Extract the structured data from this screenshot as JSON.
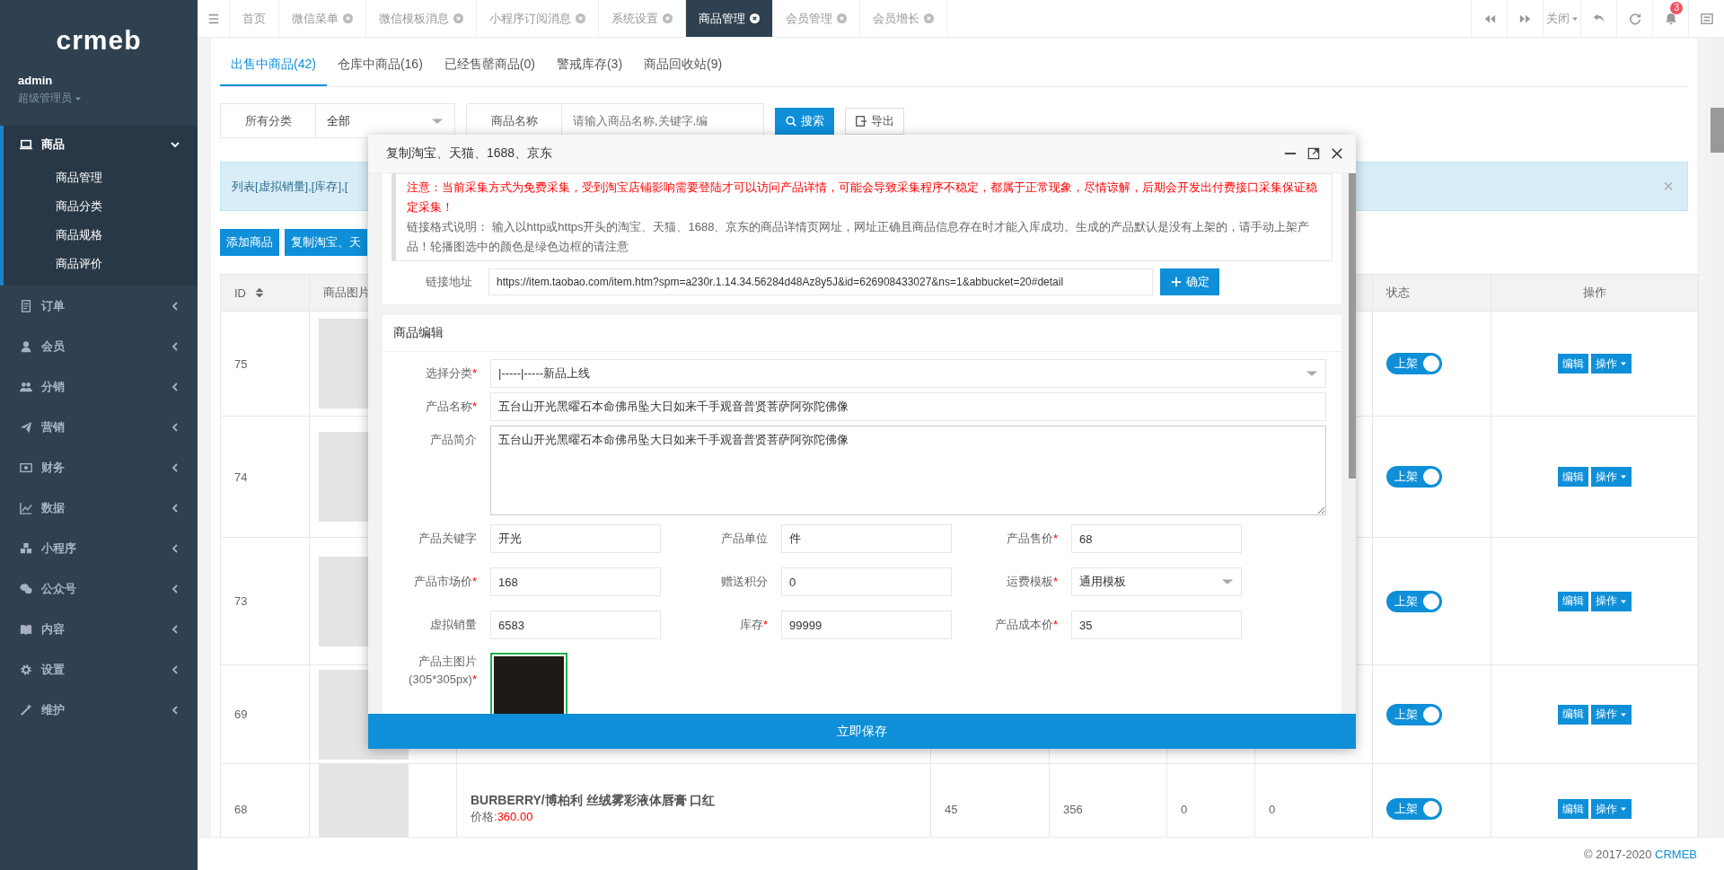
{
  "sidebar": {
    "logo": "crmeb",
    "user": {
      "name": "admin",
      "role": "超级管理员"
    },
    "menu": [
      {
        "label": "商品",
        "selected": true,
        "expanded": true,
        "children": [
          {
            "label": "商品管理"
          },
          {
            "label": "商品分类"
          },
          {
            "label": "商品规格"
          },
          {
            "label": "商品评价"
          }
        ]
      },
      {
        "label": "订单",
        "selected": false,
        "expanded": false
      },
      {
        "label": "会员",
        "selected": false,
        "expanded": false
      },
      {
        "label": "分销",
        "selected": false,
        "expanded": false
      },
      {
        "label": "营销",
        "selected": false,
        "expanded": false
      },
      {
        "label": "财务",
        "selected": false,
        "expanded": false
      },
      {
        "label": "数据",
        "selected": false,
        "expanded": false
      },
      {
        "label": "小程序",
        "selected": false,
        "expanded": false
      },
      {
        "label": "公众号",
        "selected": false,
        "expanded": false
      },
      {
        "label": "内容",
        "selected": false,
        "expanded": false
      },
      {
        "label": "设置",
        "selected": false,
        "expanded": false
      },
      {
        "label": "维护",
        "selected": false,
        "expanded": false
      }
    ]
  },
  "top_tabs": [
    {
      "label": "首页",
      "closable": false,
      "selected": false
    },
    {
      "label": "微信菜单",
      "closable": true,
      "selected": false
    },
    {
      "label": "微信模板消息",
      "closable": true,
      "selected": false
    },
    {
      "label": "小程序订阅消息",
      "closable": true,
      "selected": false
    },
    {
      "label": "系统设置",
      "closable": true,
      "selected": false
    },
    {
      "label": "商品管理",
      "closable": true,
      "selected": true
    },
    {
      "label": "会员管理",
      "closable": true,
      "selected": false
    },
    {
      "label": "会员增长",
      "closable": true,
      "selected": false
    }
  ],
  "toolbar": {
    "close_menu": "关闭",
    "notification_count": "3"
  },
  "page_tabs": [
    {
      "label": "出售中商品(42)",
      "selected": true
    },
    {
      "label": "仓库中商品(16)",
      "selected": false
    },
    {
      "label": "已经售罄商品(0)",
      "selected": false
    },
    {
      "label": "警戒库存(3)",
      "selected": false
    },
    {
      "label": "商品回收站(9)",
      "selected": false
    }
  ],
  "filters": {
    "category_label": "所有分类",
    "category_value": "全部",
    "name_label": "商品名称",
    "name_placeholder": "请输入商品名称,关键字,编",
    "search_button": "搜索",
    "export_button": "导出"
  },
  "alert": {
    "text": "列表[虚拟销量],[库存],[",
    "close": "×"
  },
  "actions": [
    "添加商品",
    "复制淘宝、天"
  ],
  "table": {
    "columns": {
      "id": "ID",
      "image": "商品图片",
      "status": "状态",
      "actions": "操作"
    },
    "rows": [
      {
        "id": "75",
        "status": "上架",
        "on": true,
        "edit": "编辑",
        "more": "操作"
      },
      {
        "id": "74",
        "status": "上架",
        "on": true,
        "edit": "编辑",
        "more": "操作"
      },
      {
        "id": "73",
        "status": "上架",
        "on": true,
        "edit": "编辑",
        "more": "操作"
      },
      {
        "id": "69",
        "status": "上架",
        "on": true,
        "edit": "编辑",
        "more": "操作"
      },
      {
        "id": "68",
        "name": "BURBERRY/博柏利 丝绒雾彩液体唇膏 口红",
        "price_label": "价格:",
        "price": "360.00",
        "cells": [
          "45",
          "356",
          "0",
          "0"
        ],
        "status": "上架",
        "on": true,
        "edit": "编辑",
        "more": "操作"
      }
    ]
  },
  "footer": {
    "text": "© 2017-2020",
    "link": "CRMEB"
  },
  "modal": {
    "title": "复制淘宝、天猫、1688、京东",
    "notice_warning": "注意：当前采集方式为免费采集，受到淘宝店铺影响需要登陆才可以访问产品详情，可能会导致采集程序不稳定，都属于正常现象，尽情谅解，后期会开发出付费接口采集保证稳定采集！",
    "notice_help": "链接格式说明： 输入以http或https开头的淘宝、天猫、1688、京东的商品详情页网址，网址正确且商品信息存在时才能入库成功。生成的产品默认是没有上架的，请手动上架产品！轮播图选中的颜色是绿色边框的请注意",
    "link_label": "链接地址",
    "link_value": "https://item.taobao.com/item.htm?spm=a230r.1.14.34.56284d48Az8y5J&id=626908433027&ns=1&abbucket=20#detail",
    "confirm_button": "确定",
    "section_title": "商品编辑",
    "fields_full": [
      {
        "label": "选择分类",
        "required": "*",
        "value": "|-----|-----新品上线",
        "kind": "select"
      },
      {
        "label": "产品名称",
        "required": "*",
        "value": "五台山开光黑曜石本命佛吊坠大日如来千手观音普贤菩萨阿弥陀佛像",
        "kind": "input"
      },
      {
        "label": "产品简介",
        "value": "五台山开光黑曜石本命佛吊坠大日如来千手观音普贤菩萨阿弥陀佛像",
        "kind": "textarea"
      }
    ],
    "fields_grid": [
      {
        "label": "产品关键字",
        "value": "开光",
        "kind": "input"
      },
      {
        "label": "产品单位",
        "value": "件",
        "kind": "input"
      },
      {
        "label": "产品售价",
        "required": "*",
        "value": "68",
        "kind": "input"
      },
      {
        "label": "产品市场价",
        "required": "*",
        "value": "168",
        "kind": "input"
      },
      {
        "label": "赠送积分",
        "value": "0",
        "kind": "input"
      },
      {
        "label": "运费模板",
        "required": "*",
        "value": "通用模板",
        "kind": "select"
      },
      {
        "label": "虚拟销量",
        "value": "6583",
        "kind": "input"
      },
      {
        "label": "库存",
        "required": "*",
        "value": "99999",
        "kind": "input"
      },
      {
        "label": "产品成本价",
        "required": "*",
        "value": "35",
        "kind": "input"
      }
    ],
    "image": {
      "label": "产品主图片",
      "hint": "(305*305px)",
      "required": "*",
      "selected": true
    },
    "save_button": "立即保存"
  }
}
